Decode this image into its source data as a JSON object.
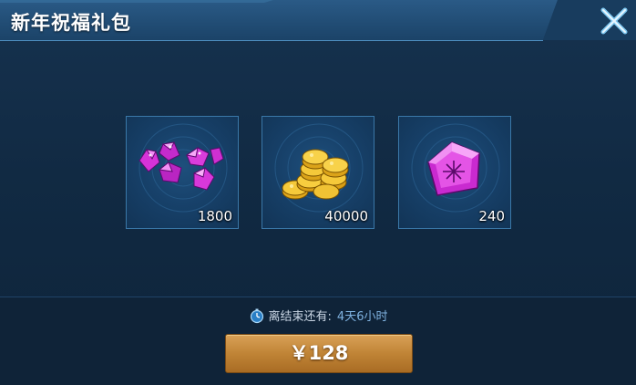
{
  "header": {
    "title": "新年祝福礼包"
  },
  "items": [
    {
      "quantity": "1800",
      "icon": "gem-pile-icon"
    },
    {
      "quantity": "40000",
      "icon": "gold-coins-icon"
    },
    {
      "quantity": "240",
      "icon": "pentagon-crystal-icon"
    }
  ],
  "timer": {
    "label": "离结束还有:",
    "value": "4天6小时"
  },
  "buy_button": {
    "label": "￥128"
  },
  "colors": {
    "accent": "#c08436",
    "panel": "#16324f",
    "timer_value": "#7fb2e0"
  }
}
